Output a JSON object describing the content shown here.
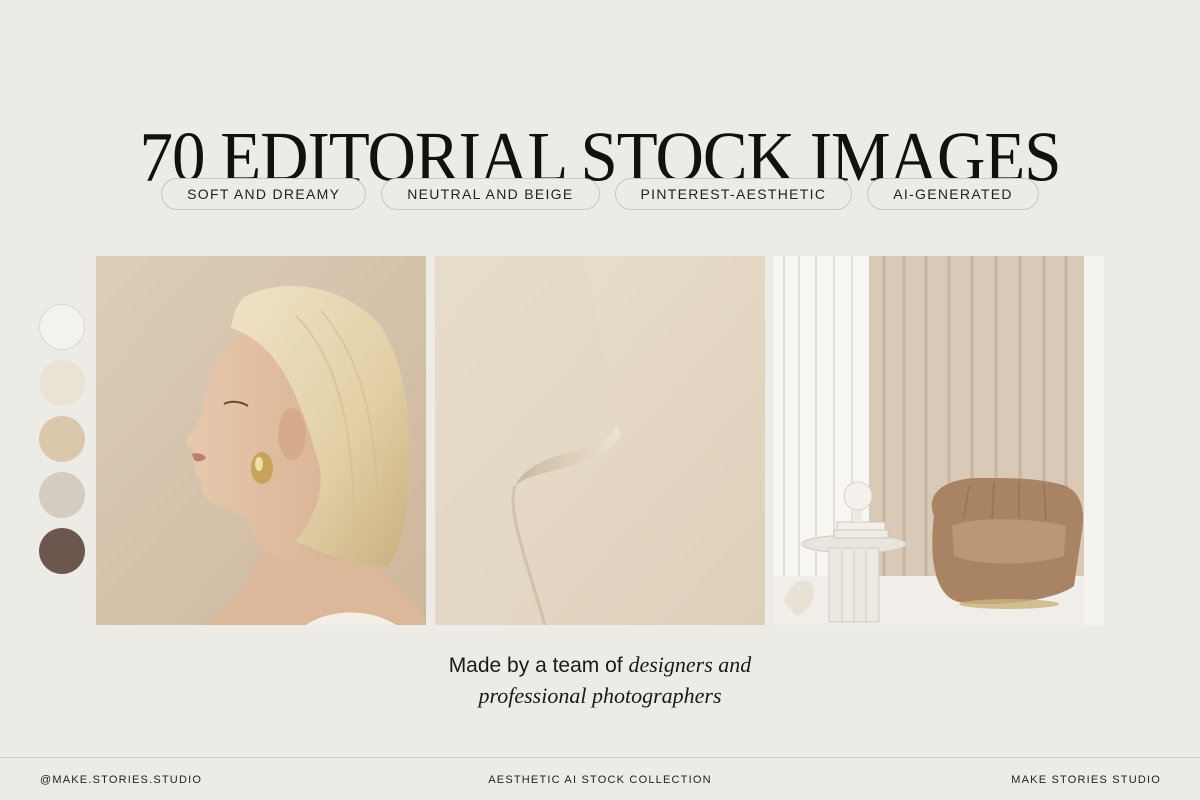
{
  "title": "70 EDITORIAL STOCK IMAGES",
  "tags": [
    "SOFT AND DREAMY",
    "NEUTRAL AND BEIGE",
    "PINTEREST-AESTHETIC",
    "AI-GENERATED"
  ],
  "palette": [
    "#f3f2ee",
    "#ebe2d6",
    "#dbc8ac",
    "#d4cbc1",
    "#6c574f"
  ],
  "tagline": {
    "plain": "Made by a team of",
    "italic_1": "designers and",
    "italic_2": "professional photographers"
  },
  "footer": {
    "left": "@MAKE.STORIES.STUDIO",
    "center": "AESTHETIC AI STOCK COLLECTION",
    "right": "MAKE STORIES STUDIO"
  }
}
